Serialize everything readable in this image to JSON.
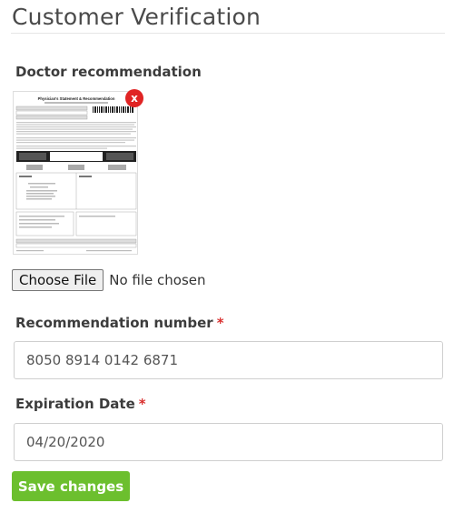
{
  "page": {
    "title": "Customer Verification"
  },
  "doctor_recommendation": {
    "label": "Doctor recommendation",
    "document_title": "Physician's Statement & Recommendation",
    "remove_icon_glyph": "x",
    "file_button_label": "Choose File",
    "file_status": "No file chosen"
  },
  "recommendation_number": {
    "label": "Recommendation number",
    "required_mark": "*",
    "value": "8050 8914 0142 6871"
  },
  "expiration_date": {
    "label": "Expiration Date",
    "required_mark": "*",
    "value": "04/20/2020"
  },
  "actions": {
    "save_label": "Save changes"
  },
  "colors": {
    "accent_green": "#6cbf2e",
    "required_red": "#d9302f",
    "remove_badge_red": "#e02424"
  },
  "icons": {
    "remove": "close-icon"
  }
}
